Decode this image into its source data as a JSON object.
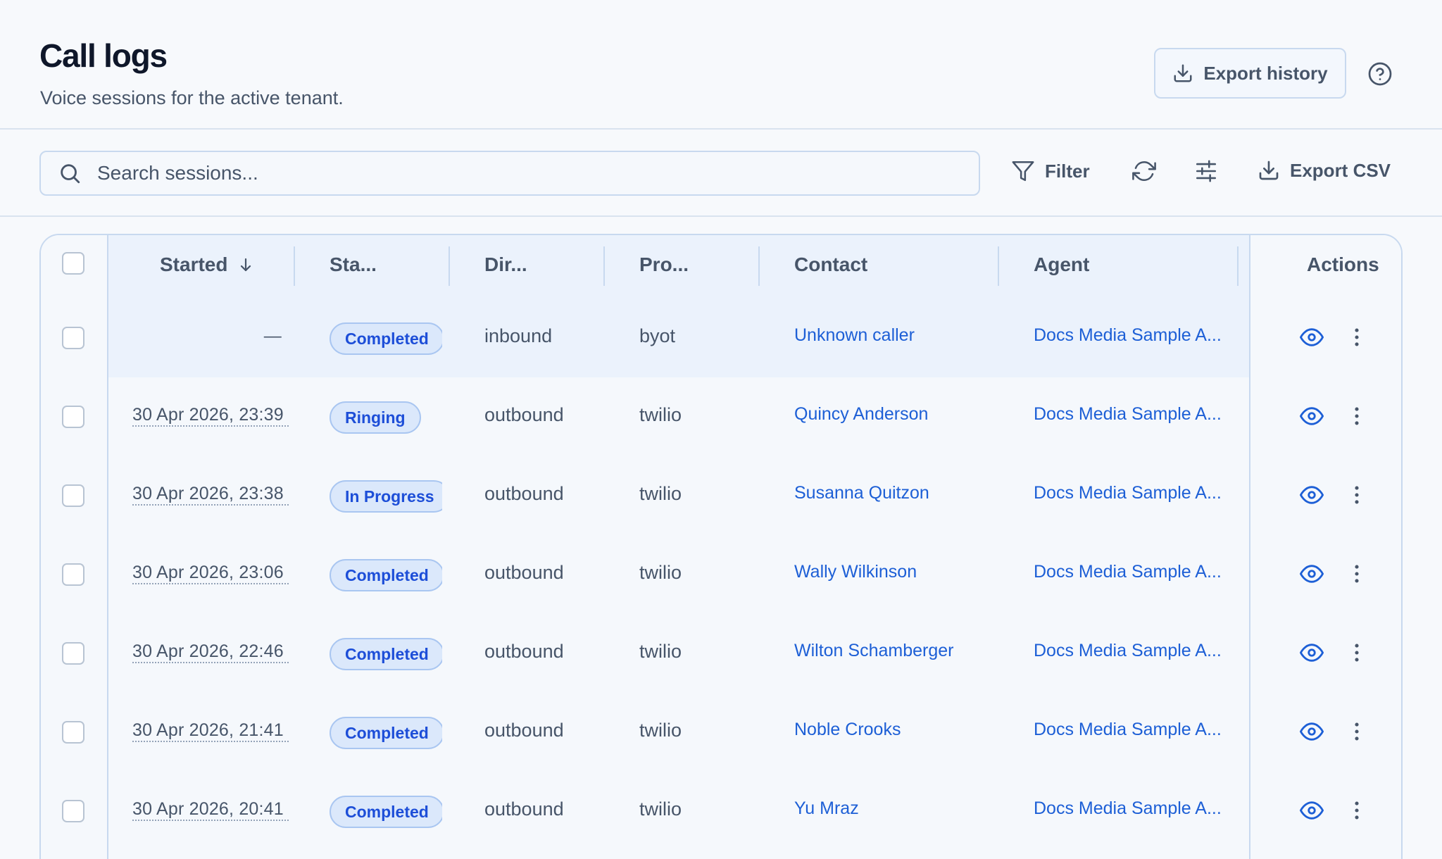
{
  "header": {
    "title": "Call logs",
    "subtitle": "Voice sessions for the active tenant.",
    "export_history_label": "Export history"
  },
  "toolbar": {
    "search_placeholder": "Search sessions...",
    "filter_label": "Filter",
    "export_csv_label": "Export CSV"
  },
  "table": {
    "columns": {
      "started": "Started",
      "status": "Sta...",
      "direction": "Dir...",
      "provider": "Pro...",
      "contact": "Contact",
      "agent": "Agent",
      "actions": "Actions"
    },
    "rows": [
      {
        "started": "—",
        "status": "Completed",
        "direction": "inbound",
        "provider": "byot",
        "contact": "Unknown caller",
        "agent": "Docs Media Sample A..."
      },
      {
        "started": "30 Apr 2026, 23:39",
        "status": "Ringing",
        "direction": "outbound",
        "provider": "twilio",
        "contact": "Quincy Anderson",
        "agent": "Docs Media Sample A..."
      },
      {
        "started": "30 Apr 2026, 23:38",
        "status": "In Progress",
        "direction": "outbound",
        "provider": "twilio",
        "contact": "Susanna Quitzon",
        "agent": "Docs Media Sample A..."
      },
      {
        "started": "30 Apr 2026, 23:06",
        "status": "Completed",
        "direction": "outbound",
        "provider": "twilio",
        "contact": "Wally Wilkinson",
        "agent": "Docs Media Sample A..."
      },
      {
        "started": "30 Apr 2026, 22:46",
        "status": "Completed",
        "direction": "outbound",
        "provider": "twilio",
        "contact": "Wilton Schamberger",
        "agent": "Docs Media Sample A..."
      },
      {
        "started": "30 Apr 2026, 21:41",
        "status": "Completed",
        "direction": "outbound",
        "provider": "twilio",
        "contact": "Noble Crooks",
        "agent": "Docs Media Sample A..."
      },
      {
        "started": "30 Apr 2026, 20:41",
        "status": "Completed",
        "direction": "outbound",
        "provider": "twilio",
        "contact": "Yu Mraz",
        "agent": "Docs Media Sample A..."
      }
    ]
  },
  "colors": {
    "accent": "#1d5fd6",
    "badge_bg": "#dbe8fb",
    "badge_text": "#1d4ed8",
    "border": "#c8d9ef",
    "muted_text": "#475569"
  },
  "icons": [
    "download-icon",
    "help-icon",
    "search-icon",
    "filter-icon",
    "refresh-icon",
    "sliders-icon",
    "sort-down-icon",
    "eye-icon",
    "more-vertical-icon"
  ]
}
